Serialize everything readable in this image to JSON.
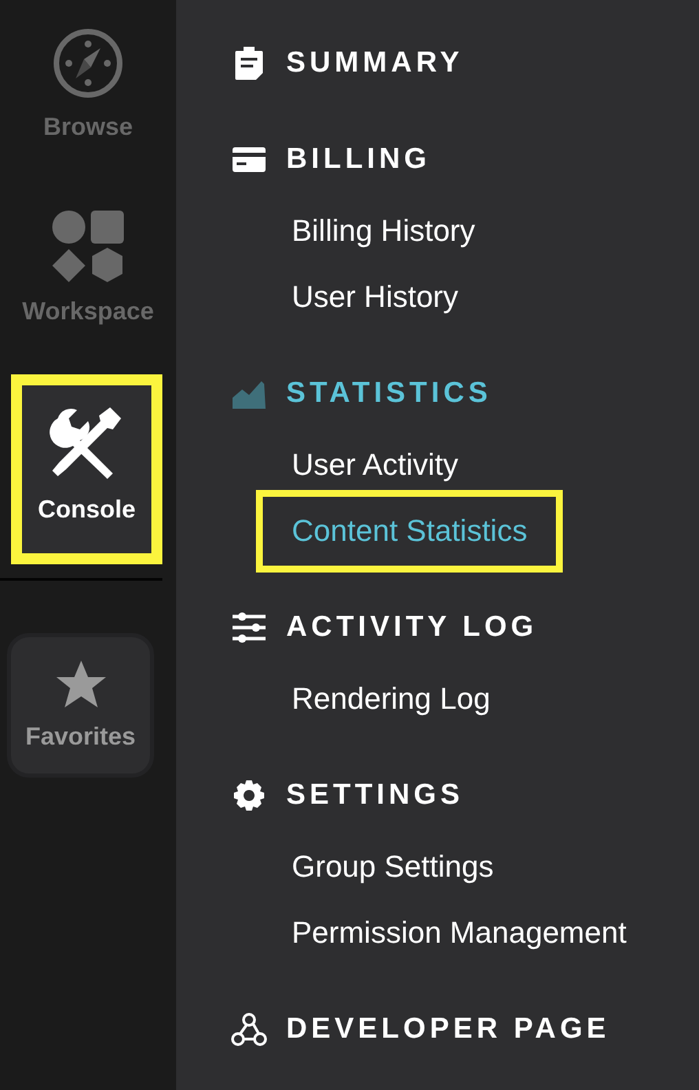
{
  "rail": [
    {
      "label": "Browse",
      "kind": "nav",
      "selected": false,
      "highlighted": false
    },
    {
      "label": "Workspace",
      "kind": "nav",
      "selected": false,
      "highlighted": false
    },
    {
      "label": "Console",
      "kind": "nav",
      "selected": true,
      "highlighted": true
    },
    {
      "label": "Favorites",
      "kind": "pinned",
      "selected": false,
      "highlighted": false
    }
  ],
  "sections": [
    {
      "title": "SUMMARY",
      "selected": false
    },
    {
      "title": "BILLING",
      "selected": false,
      "items": [
        {
          "label": "Billing History",
          "selected": false,
          "highlighted": false
        },
        {
          "label": "User History",
          "selected": false,
          "highlighted": false
        }
      ]
    },
    {
      "title": "STATISTICS",
      "selected": true,
      "items": [
        {
          "label": "User Activity",
          "selected": false,
          "highlighted": false
        },
        {
          "label": "Content Statistics",
          "selected": true,
          "highlighted": true
        }
      ]
    },
    {
      "title": "ACTIVITY LOG",
      "selected": false,
      "items": [
        {
          "label": "Rendering Log",
          "selected": false,
          "highlighted": false
        }
      ]
    },
    {
      "title": "SETTINGS",
      "selected": false,
      "items": [
        {
          "label": "Group Settings",
          "selected": false,
          "highlighted": false
        },
        {
          "label": "Permission Management",
          "selected": false,
          "highlighted": false
        }
      ]
    },
    {
      "title": "DEVELOPER PAGE",
      "selected": false
    }
  ]
}
